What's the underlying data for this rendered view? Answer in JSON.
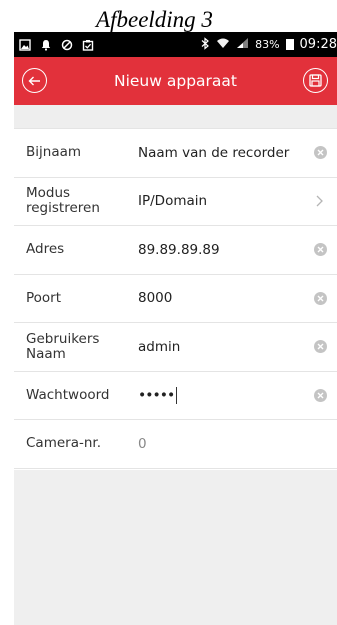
{
  "caption": "Afbeelding 3",
  "statusbar": {
    "icons_left": [
      "image-icon",
      "bell-icon",
      "blocked-icon",
      "clipboard-icon"
    ],
    "icons_right": [
      "bluetooth-icon",
      "wifi-icon",
      "signal-icon",
      "battery-icon"
    ],
    "battery": "83%",
    "time": "09:28"
  },
  "appbar": {
    "title": "Nieuw apparaat",
    "color": "#e2313b",
    "back_icon": "back-arrow-icon",
    "save_icon": "floppy-disk-icon"
  },
  "form": {
    "rows": [
      {
        "label": "Bijnaam",
        "value": "Naam van de recorder",
        "action": "clear"
      },
      {
        "label": "Modus registreren",
        "value": "IP/Domain",
        "action": "chevron"
      },
      {
        "label": "Adres",
        "value": "89.89.89.89",
        "action": "clear"
      },
      {
        "label": "Poort",
        "value": "8000",
        "action": "clear"
      },
      {
        "label": "Gebruikers Naam",
        "value": "admin",
        "action": "clear"
      },
      {
        "label": "Wachtwoord",
        "value": "•••••",
        "action": "clear"
      },
      {
        "label": "Camera-nr.",
        "value": "0",
        "action": "none"
      }
    ]
  }
}
